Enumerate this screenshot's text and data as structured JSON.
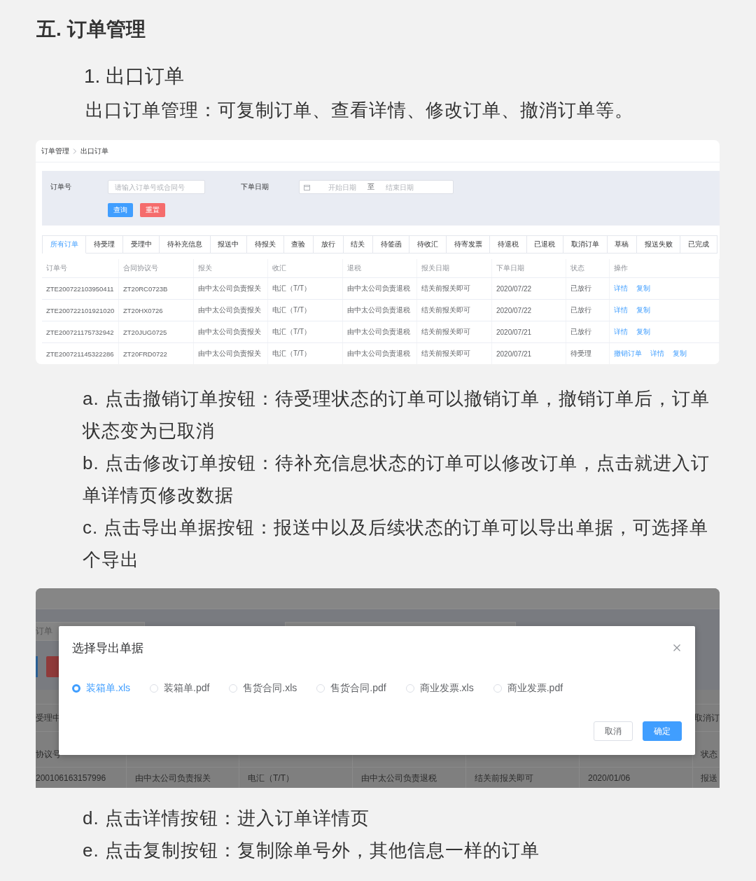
{
  "section_title": "五. 订单管理",
  "subsection_title": "1. 出口订单",
  "intro": "出口订单管理：可复制订单、查看详情、修改订单、撤消订单等。",
  "order_screen": {
    "breadcrumb": [
      "订单管理",
      "出口订单"
    ],
    "filters": {
      "order_label": "订单号",
      "order_placeholder": "请输入订单号或合同号",
      "date_label": "下单日期",
      "start_placeholder": "开始日期",
      "range_separator": "至",
      "end_placeholder": "结束日期"
    },
    "buttons": [
      {
        "label": "查询",
        "kind": "primary"
      },
      {
        "label": "重置",
        "kind": "danger"
      }
    ],
    "tabs": [
      {
        "label": "所有订单",
        "selected": true
      },
      {
        "label": "待受理",
        "selected": false
      },
      {
        "label": "受理中",
        "selected": false
      },
      {
        "label": "待补充信息",
        "selected": false
      },
      {
        "label": "报送中",
        "selected": false
      },
      {
        "label": "待报关",
        "selected": false
      },
      {
        "label": "查验",
        "selected": false
      },
      {
        "label": "放行",
        "selected": false
      },
      {
        "label": "结关",
        "selected": false
      },
      {
        "label": "待签函",
        "selected": false
      },
      {
        "label": "待收汇",
        "selected": false
      },
      {
        "label": "待寄发票",
        "selected": false
      },
      {
        "label": "待退税",
        "selected": false
      },
      {
        "label": "已退税",
        "selected": false
      },
      {
        "label": "取消订单",
        "selected": false
      },
      {
        "label": "草稿",
        "selected": false
      },
      {
        "label": "报送失败",
        "selected": false
      },
      {
        "label": "已完成",
        "selected": false
      }
    ],
    "table": {
      "columns": [
        "订单号",
        "合同协议号",
        "报关",
        "收汇",
        "退税",
        "报关日期",
        "下单日期",
        "状态",
        "操作"
      ],
      "rows": [
        {
          "cells": [
            "ZTE200722103950411",
            "ZT20RC0723B",
            "由中太公司负责报关",
            "电汇（T/T）",
            "由中太公司负责退税",
            "结关前报关即可",
            "2020/07/22",
            "已放行"
          ],
          "actions": [
            "详情",
            "复制"
          ]
        },
        {
          "cells": [
            "ZTE200722101921020",
            "ZT20HX0726",
            "由中太公司负责报关",
            "电汇（T/T）",
            "由中太公司负责退税",
            "结关前报关即可",
            "2020/07/22",
            "已放行"
          ],
          "actions": [
            "详情",
            "复制"
          ]
        },
        {
          "cells": [
            "ZTE200721175732942",
            "ZT20JUG0725",
            "由中太公司负责报关",
            "电汇（T/T）",
            "由中太公司负责退税",
            "结关前报关即可",
            "2020/07/21",
            "已放行"
          ],
          "actions": [
            "详情",
            "复制"
          ]
        },
        {
          "cells": [
            "ZTE200721145322286",
            "ZT20FRD0722",
            "由中太公司负责报关",
            "电汇（T/T）",
            "由中太公司负责退税",
            "结关前报关即可",
            "2020/07/21",
            "待受理"
          ],
          "actions": [
            "撤销订单",
            "详情",
            "复制"
          ]
        }
      ]
    }
  },
  "notes_1": [
    "a. 点击撤销订单按钮：待受理状态的订单可以撤销订单，撤销订单后，订单状态变为已取消",
    "b. 点击修改订单按钮：待补充信息状态的订单可以修改订单，点击就进入订单详情页修改数据",
    "c. 点击导出单据按钮：报送中以及后续状态的订单可以导出单据，可选择单个导出"
  ],
  "export_screen": {
    "background": {
      "field_text": "订单",
      "tabs": [
        "受理中",
        "取消订"
      ],
      "header": [
        "协议号",
        "状态"
      ],
      "row": [
        "200106163157996",
        "由中太公司负责报关",
        "电汇（T/T）",
        "由中太公司负责退税",
        "结关前报关即可",
        "2020/01/06",
        "报送"
      ]
    },
    "dialog": {
      "title": "选择导出单据",
      "options": [
        {
          "label": "装箱单.xls",
          "selected": true
        },
        {
          "label": "装箱单.pdf",
          "selected": false
        },
        {
          "label": "售货合同.xls",
          "selected": false
        },
        {
          "label": "售货合同.pdf",
          "selected": false
        },
        {
          "label": "商业发票.xls",
          "selected": false
        },
        {
          "label": "商业发票.pdf",
          "selected": false
        }
      ],
      "buttons": [
        {
          "label": "取消",
          "kind": "default"
        },
        {
          "label": "确定",
          "kind": "primary"
        }
      ]
    }
  },
  "notes_2": [
    "d. 点击详情按钮：进入订单详情页",
    "e. 点击复制按钮：复制除单号外，其他信息一样的订单"
  ]
}
